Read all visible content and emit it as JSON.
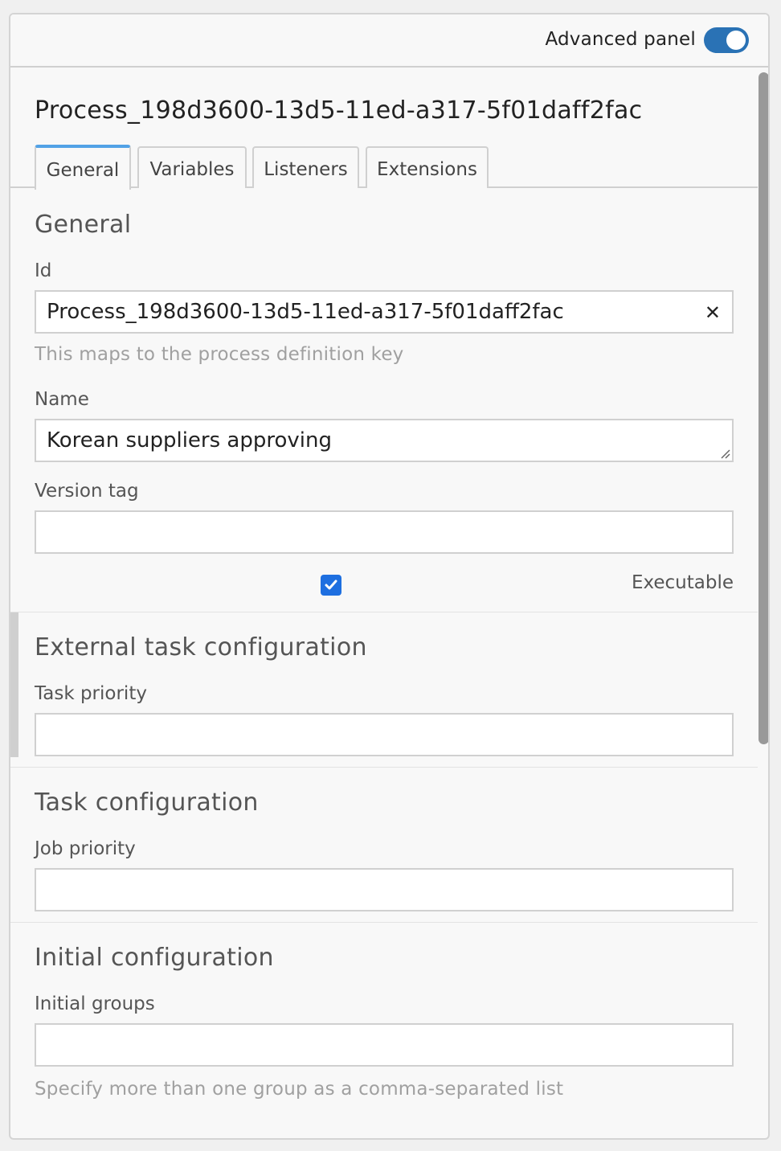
{
  "header": {
    "advanced_panel_label": "Advanced panel",
    "advanced_panel_on": true
  },
  "process": {
    "title": "Process_198d3600-13d5-11ed-a317-5f01daff2fac"
  },
  "tabs": [
    {
      "label": "General",
      "active": true
    },
    {
      "label": "Variables",
      "active": false
    },
    {
      "label": "Listeners",
      "active": false
    },
    {
      "label": "Extensions",
      "active": false
    }
  ],
  "general": {
    "title": "General",
    "id_label": "Id",
    "id_value": "Process_198d3600-13d5-11ed-a317-5f01daff2fac",
    "id_description": "This maps to the process definition key",
    "name_label": "Name",
    "name_value": "Korean suppliers approving",
    "version_tag_label": "Version tag",
    "version_tag_value": "",
    "executable_label": "Executable",
    "executable_checked": true
  },
  "external_task": {
    "title": "External task configuration",
    "task_priority_label": "Task priority",
    "task_priority_value": ""
  },
  "task_config": {
    "title": "Task configuration",
    "job_priority_label": "Job priority",
    "job_priority_value": ""
  },
  "initial_config": {
    "title": "Initial configuration",
    "initial_groups_label": "Initial groups",
    "initial_groups_value": "",
    "initial_groups_description": "Specify more than one group as a comma-separated list"
  },
  "colors": {
    "accent": "#2a72b5",
    "tab_active": "#52a2e6",
    "checkbox": "#1e6fe0"
  }
}
